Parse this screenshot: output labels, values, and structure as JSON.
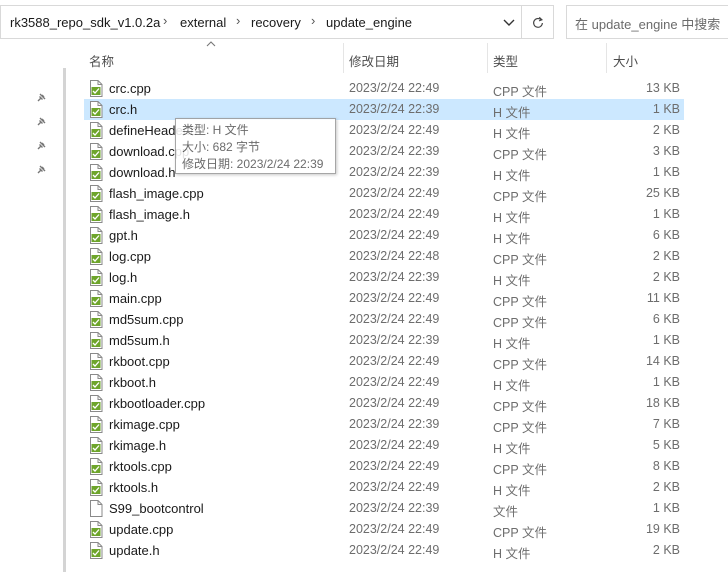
{
  "address": {
    "crumbs": [
      "rk3588_repo_sdk_v1.0.2a",
      "external",
      "recovery",
      "update_engine"
    ],
    "separator": "›"
  },
  "search": {
    "placeholder": "在 update_engine 中搜索"
  },
  "columns": {
    "name": "名称",
    "date": "修改日期",
    "type": "类型",
    "size": "大小"
  },
  "files": [
    {
      "name": "crc.cpp",
      "date": "2023/2/24 22:49",
      "type": "CPP 文件",
      "size": "13 KB",
      "icon": "cpp-file-icon"
    },
    {
      "name": "crc.h",
      "date": "2023/2/24 22:39",
      "type": "H 文件",
      "size": "1 KB",
      "icon": "h-file-icon",
      "selected": true
    },
    {
      "name": "defineHeader.h",
      "date": "2023/2/24 22:49",
      "type": "H 文件",
      "size": "2 KB",
      "icon": "h-file-icon"
    },
    {
      "name": "download.cpp",
      "date": "2023/2/24 22:39",
      "type": "CPP 文件",
      "size": "3 KB",
      "icon": "cpp-file-icon"
    },
    {
      "name": "download.h",
      "date": "2023/2/24 22:39",
      "type": "H 文件",
      "size": "1 KB",
      "icon": "h-file-icon"
    },
    {
      "name": "flash_image.cpp",
      "date": "2023/2/24 22:49",
      "type": "CPP 文件",
      "size": "25 KB",
      "icon": "cpp-file-icon"
    },
    {
      "name": "flash_image.h",
      "date": "2023/2/24 22:49",
      "type": "H 文件",
      "size": "1 KB",
      "icon": "h-file-icon"
    },
    {
      "name": "gpt.h",
      "date": "2023/2/24 22:49",
      "type": "H 文件",
      "size": "6 KB",
      "icon": "h-file-icon"
    },
    {
      "name": "log.cpp",
      "date": "2023/2/24 22:48",
      "type": "CPP 文件",
      "size": "2 KB",
      "icon": "cpp-file-icon"
    },
    {
      "name": "log.h",
      "date": "2023/2/24 22:39",
      "type": "H 文件",
      "size": "2 KB",
      "icon": "h-file-icon"
    },
    {
      "name": "main.cpp",
      "date": "2023/2/24 22:49",
      "type": "CPP 文件",
      "size": "11 KB",
      "icon": "cpp-file-icon"
    },
    {
      "name": "md5sum.cpp",
      "date": "2023/2/24 22:49",
      "type": "CPP 文件",
      "size": "6 KB",
      "icon": "cpp-file-icon"
    },
    {
      "name": "md5sum.h",
      "date": "2023/2/24 22:39",
      "type": "H 文件",
      "size": "1 KB",
      "icon": "h-file-icon"
    },
    {
      "name": "rkboot.cpp",
      "date": "2023/2/24 22:49",
      "type": "CPP 文件",
      "size": "14 KB",
      "icon": "cpp-file-icon"
    },
    {
      "name": "rkboot.h",
      "date": "2023/2/24 22:49",
      "type": "H 文件",
      "size": "1 KB",
      "icon": "h-file-icon"
    },
    {
      "name": "rkbootloader.cpp",
      "date": "2023/2/24 22:49",
      "type": "CPP 文件",
      "size": "18 KB",
      "icon": "cpp-file-icon"
    },
    {
      "name": "rkimage.cpp",
      "date": "2023/2/24 22:39",
      "type": "CPP 文件",
      "size": "7 KB",
      "icon": "cpp-file-icon"
    },
    {
      "name": "rkimage.h",
      "date": "2023/2/24 22:49",
      "type": "H 文件",
      "size": "5 KB",
      "icon": "h-file-icon"
    },
    {
      "name": "rktools.cpp",
      "date": "2023/2/24 22:49",
      "type": "CPP 文件",
      "size": "8 KB",
      "icon": "cpp-file-icon"
    },
    {
      "name": "rktools.h",
      "date": "2023/2/24 22:49",
      "type": "H 文件",
      "size": "2 KB",
      "icon": "h-file-icon"
    },
    {
      "name": "S99_bootcontrol",
      "date": "2023/2/24 22:39",
      "type": "文件",
      "size": "1 KB",
      "icon": "generic-file-icon"
    },
    {
      "name": "update.cpp",
      "date": "2023/2/24 22:49",
      "type": "CPP 文件",
      "size": "19 KB",
      "icon": "cpp-file-icon"
    },
    {
      "name": "update.h",
      "date": "2023/2/24 22:49",
      "type": "H 文件",
      "size": "2 KB",
      "icon": "h-file-icon"
    }
  ],
  "tooltip": {
    "type_line": "类型: H 文件",
    "size_line": "大小: 682 字节",
    "date_line": "修改日期: 2023/2/24 22:39"
  },
  "colors": {
    "selected_row": "#cce8ff",
    "file_icon_green": "#6ea52b"
  }
}
